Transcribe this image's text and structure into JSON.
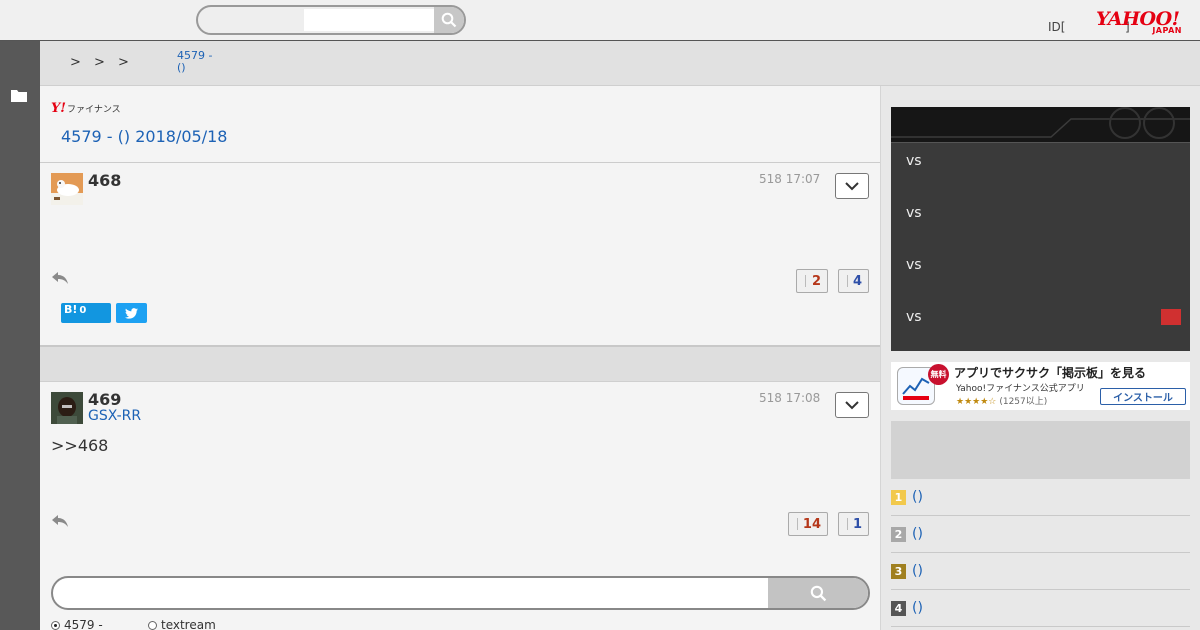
{
  "header": {
    "search_placeholder": "",
    "id_text": "ID[",
    "bracket_text": "]",
    "logo_main": "YAHOO!",
    "logo_sub": "JAPAN"
  },
  "breadcrumb": {
    "separators": [
      ">",
      ">",
      ">"
    ],
    "current": "4579 -\n()"
  },
  "main": {
    "brand_y": "Y!",
    "brand_text": "ファイナンス",
    "title": "4579 - () 2018/05/18"
  },
  "posts": [
    {
      "number": "468",
      "user": "",
      "time": "518 17:07",
      "body": "",
      "votes_up": "2",
      "votes_down": "4"
    },
    {
      "number": "469",
      "user": "GSX-RR",
      "time": "518 17:08",
      "body": ">>468",
      "votes_up": "14",
      "votes_down": "1"
    }
  ],
  "share": {
    "hatena_label": "B!",
    "hatena_count": "0"
  },
  "search_bottom": {
    "option1": "4579 -",
    "option2": "textream"
  },
  "baseball": {
    "games": [
      "vs",
      "vs",
      "vs",
      "vs"
    ]
  },
  "app_banner": {
    "free": "無料",
    "title": "アプリでサクサク「掲示板」を見る",
    "subtitle": "Yahoo!ファイナンス公式アプリ",
    "stars": "★★★★☆",
    "rating": "(1257以上)",
    "install": "インストール"
  },
  "ranking": {
    "items": [
      {
        "rank": "1",
        "label": "()",
        "color": "#f2c94c"
      },
      {
        "rank": "2",
        "label": "()",
        "color": "#a8a8a8"
      },
      {
        "rank": "3",
        "label": "()",
        "color": "#a08020"
      },
      {
        "rank": "4",
        "label": "()",
        "color": "#555555"
      }
    ]
  }
}
